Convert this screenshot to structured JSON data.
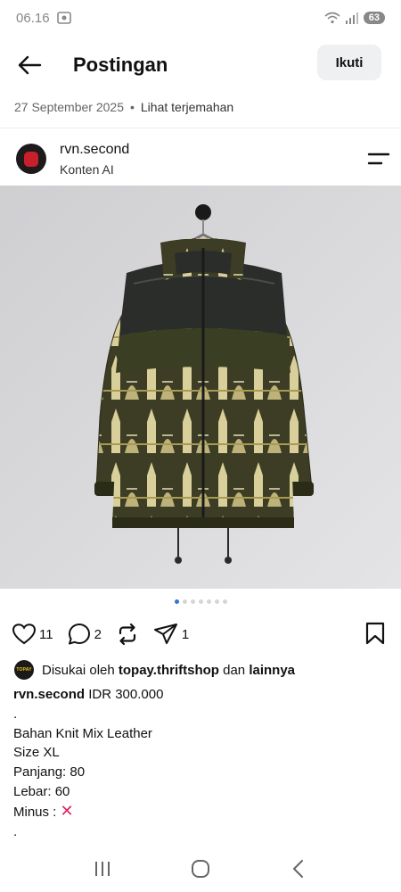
{
  "status_bar": {
    "time": "06.16",
    "battery": "63"
  },
  "header": {
    "title": "Postingan",
    "follow_label": "Ikuti"
  },
  "meta": {
    "date": "27 September 2025",
    "separator": "•",
    "translate_label": "Lihat terjemahan"
  },
  "author": {
    "name": "rvn.second",
    "subtitle": "Konten AI"
  },
  "carousel": {
    "dot_count": 7,
    "active_index": 0
  },
  "actions": {
    "likes": "11",
    "comments": "2",
    "shares": "1"
  },
  "liked_by": {
    "avatar_text": "TOPAY",
    "prefix": "Disukai oleh",
    "user": "topay.thriftshop",
    "middle": "dan",
    "others": "lainnya"
  },
  "caption": {
    "author": "rvn.second",
    "first_line": " IDR 300.000",
    "lines": [
      ".",
      "Bahan Knit Mix Leather",
      "Size XL",
      "Panjang: 80",
      "Lebar: 60",
      "Minus : "
    ],
    "minus_mark": "✕",
    "trailing": "."
  },
  "colors": {
    "accent": "#3b6fd8",
    "follow_bg": "#eef0f2",
    "image_bg": "#d5d5d7"
  }
}
